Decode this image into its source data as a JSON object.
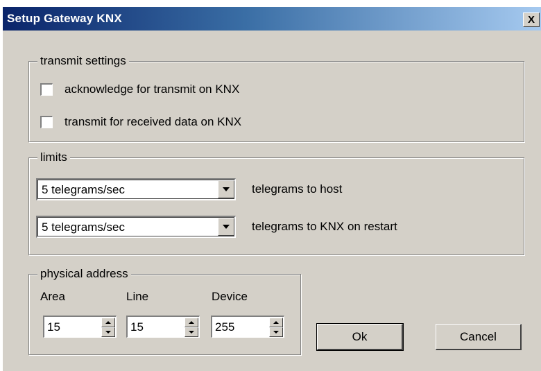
{
  "window": {
    "title": "Setup Gateway KNX",
    "close_glyph": "X"
  },
  "transmit_settings": {
    "legend": "transmit settings",
    "checkboxes": [
      {
        "label": "acknowledge for transmit on KNX",
        "checked": false
      },
      {
        "label": "transmit for received data on KNX",
        "checked": false
      }
    ]
  },
  "limits": {
    "legend": "limits",
    "rows": [
      {
        "value": "5 telegrams/sec",
        "label": "telegrams to host"
      },
      {
        "value": "5 telegrams/sec",
        "label": "telegrams to KNX on restart"
      }
    ]
  },
  "physical_address": {
    "legend": "physical address",
    "fields": [
      {
        "label": "Area",
        "value": "15"
      },
      {
        "label": "Line",
        "value": "15"
      },
      {
        "label": "Device",
        "value": "255"
      }
    ]
  },
  "buttons": {
    "ok": "Ok",
    "cancel": "Cancel"
  },
  "icons": {
    "dropdown": "chevron-down-icon",
    "spin_up": "arrow-up-icon",
    "spin_down": "arrow-down-icon",
    "close": "close-icon"
  },
  "colors": {
    "dialog_bg": "#d4d0c8",
    "title_start": "#0a246a",
    "title_end": "#a6caf0",
    "title_text": "#ffffff"
  }
}
